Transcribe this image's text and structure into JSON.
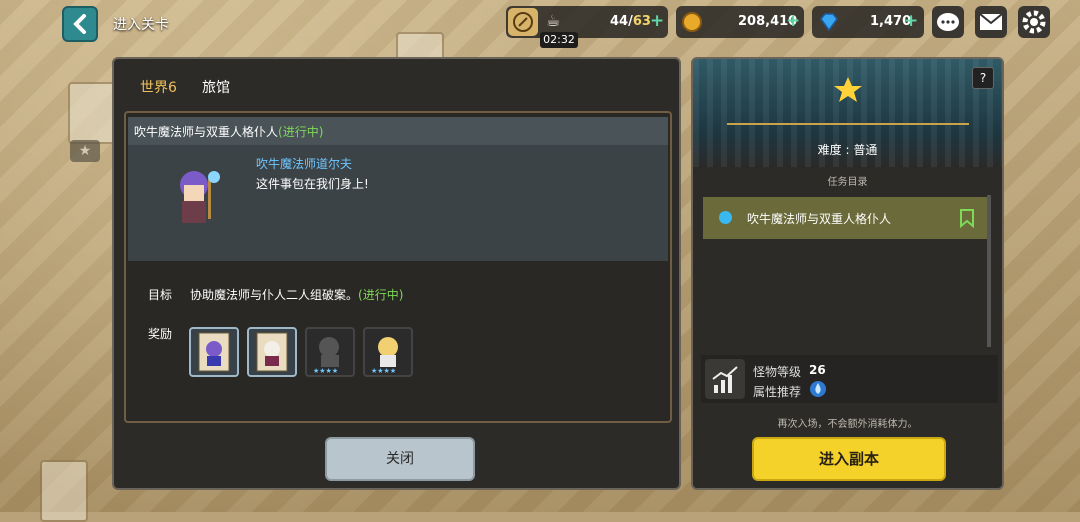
{
  "header": {
    "title": "进入关卡",
    "stamina": {
      "current": "44",
      "max": "63",
      "timer": "02:32"
    },
    "gold": "208,410",
    "gems": "1,470"
  },
  "left_panel": {
    "tabs": [
      "世界6",
      "旅馆"
    ],
    "quest": {
      "title": "吹牛魔法师与双重人格仆人",
      "title_status": "(进行中)",
      "npc_name": "吹牛魔法师道尔夫",
      "npc_line": "这件事包在我们身上!",
      "goal_label": "目标",
      "goal_text": "协助魔法师与仆人二人组破案。",
      "goal_status": "(进行中)",
      "reward_label": "奖励"
    },
    "close_label": "关闭"
  },
  "right_panel": {
    "help": "?",
    "difficulty_label": "难度",
    "difficulty_sep": ":",
    "difficulty_value": "普通",
    "mission_list_label": "任务目录",
    "mission_item": "吹牛魔法师与双重人格仆人",
    "monster_level_label": "怪物等级",
    "monster_level_value": "26",
    "attribute_label": "属性推荐",
    "note": "再次入场，不会额外消耗体力。",
    "enter_label": "进入副本"
  },
  "colors": {
    "accent_yellow": "#f5d22a",
    "status_green": "#7ed957",
    "npc_name_blue": "#6fc6ff",
    "tab_active": "#f0c060"
  }
}
